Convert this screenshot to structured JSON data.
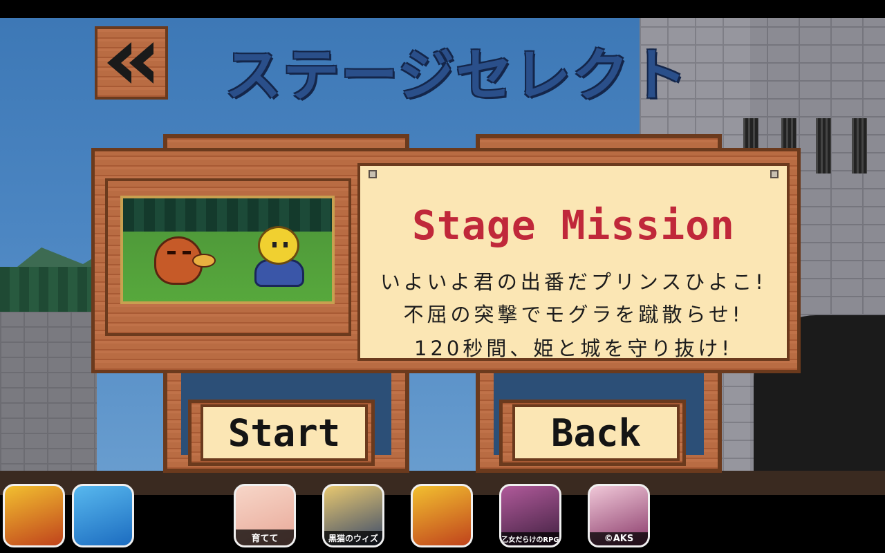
{
  "screen": {
    "title": "ステージセレクト",
    "back_icon": "double-arrow-left-icon"
  },
  "mission": {
    "heading": "Stage Mission",
    "lines": [
      "いよいよ君の出番だプリンスひよこ!",
      "不屈の突撃でモグラを蹴散らせ!",
      "120秒間、姫と城を守り抜け!"
    ]
  },
  "buttons": {
    "start": "Start",
    "back": "Back"
  },
  "ads": [
    {
      "icon": "clash-barbarian-icon",
      "label": ""
    },
    {
      "icon": "cartoon-cow-icon",
      "label": ""
    },
    {
      "icon": "pigs-icon",
      "label": "育てて"
    },
    {
      "icon": "kuroneko-wiz-icon",
      "label": "黒猫のウィズ"
    },
    {
      "icon": "clash-barbarian-icon",
      "label": ""
    },
    {
      "icon": "otome-rpg-icon",
      "label": "乙女だらけのRPG"
    },
    {
      "icon": "idol-portrait-icon",
      "label": "©AKS"
    }
  ],
  "colors": {
    "wood": "#b5673f",
    "parchment": "#fbe6b4",
    "mission_red": "#c0283a",
    "title_blue": "#2a4f8a"
  }
}
